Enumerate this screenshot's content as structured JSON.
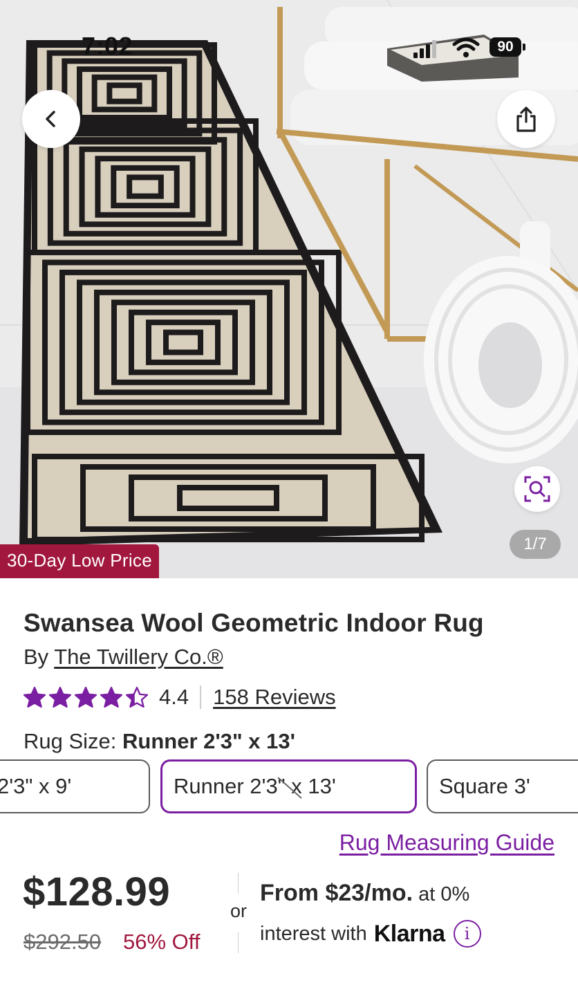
{
  "status_bar": {
    "time": "7:02",
    "battery": "90",
    "icons": [
      "cellular-signal-icon",
      "wifi-icon",
      "battery-icon"
    ]
  },
  "hero": {
    "image_counter": "1/7",
    "badge": "30-Day Low Price",
    "buttons": [
      "back-icon",
      "share-icon",
      "visual-search-icon"
    ]
  },
  "product": {
    "title": "Swansea Wool Geometric Indoor Rug",
    "by_prefix": "By",
    "brand": "The Twillery Co.®",
    "rating": "4.4",
    "rating_value": 4.4,
    "rating_max": 5,
    "reviews": "158 Reviews"
  },
  "size": {
    "label": "Rug Size:",
    "selected": "Runner 2'3\" x 13'",
    "options": [
      "2'3\" x 9'",
      "Runner 2'3\" x 13'",
      "Square 3'"
    ],
    "guide_link": "Rug Measuring Guide"
  },
  "pricing": {
    "price": "$128.99",
    "was_price": "$292.50",
    "discount": "56% Off",
    "or": "or",
    "financing_amount": "From $23/mo.",
    "financing_rate": "at 0%",
    "financing_line2": "interest with",
    "financing_provider": "Klarna"
  },
  "colors": {
    "accent": "#7b1fa2",
    "sale_red": "#a1173d",
    "text": "#2a2a2a"
  }
}
